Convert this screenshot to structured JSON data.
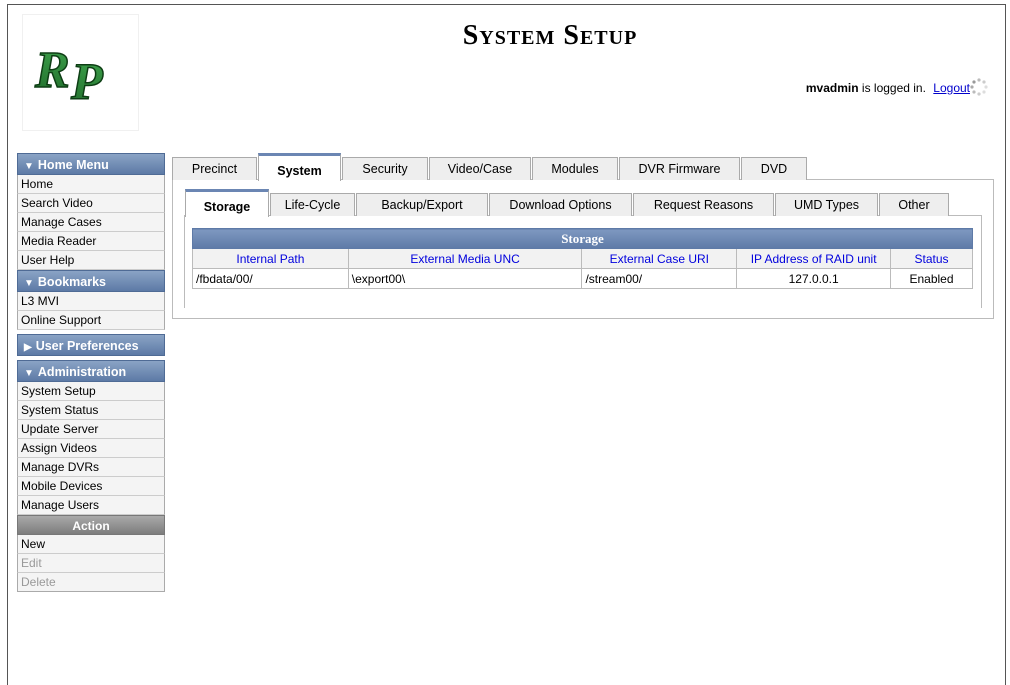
{
  "header": {
    "title": "System Setup",
    "user": "mvadmin",
    "logged_in_text": " is logged in.",
    "logout_label": "Logout"
  },
  "sidebar": {
    "home_menu": {
      "label": "Home Menu",
      "items": [
        "Home",
        "Search Video",
        "Manage Cases",
        "Media Reader",
        "User Help"
      ]
    },
    "bookmarks": {
      "label": "Bookmarks",
      "items": [
        "L3 MVI",
        "Online Support"
      ]
    },
    "user_preferences": {
      "label": "User Preferences"
    },
    "administration": {
      "label": "Administration",
      "items": [
        "System Setup",
        "System Status",
        "Update Server",
        "Assign Videos",
        "Manage DVRs",
        "Mobile Devices",
        "Manage Users"
      ]
    },
    "action": {
      "label": "Action",
      "items": [
        {
          "label": "New",
          "enabled": true
        },
        {
          "label": "Edit",
          "enabled": false
        },
        {
          "label": "Delete",
          "enabled": false
        }
      ]
    }
  },
  "main_tabs": [
    "Precinct",
    "System",
    "Security",
    "Video/Case",
    "Modules",
    "DVR Firmware",
    "DVD"
  ],
  "main_tab_active": "System",
  "sub_tabs": [
    "Storage",
    "Life-Cycle",
    "Backup/Export",
    "Download Options",
    "Request Reasons",
    "UMD Types",
    "Other"
  ],
  "sub_tab_active": "Storage",
  "storage_table": {
    "caption": "Storage",
    "columns": [
      "Internal Path",
      "External Media UNC",
      "External Case URI",
      "IP Address of RAID unit",
      "Status"
    ],
    "rows": [
      [
        "/fbdata/00/",
        "\\export00\\",
        "/stream00/",
        "127.0.0.1",
        "Enabled"
      ]
    ]
  },
  "colors": {
    "menu_header": "#6b86b3",
    "link": "#0000cc",
    "logo_green": "#2e7d32"
  }
}
